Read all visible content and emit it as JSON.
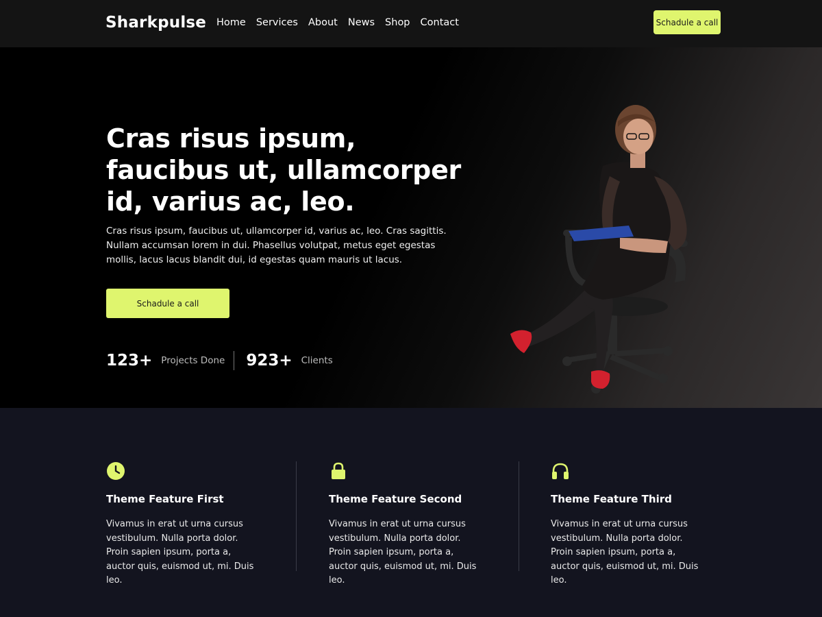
{
  "header": {
    "logo": "Sharkpulse",
    "nav": [
      "Home",
      "Services",
      "About",
      "News",
      "Shop",
      "Contact"
    ],
    "cta": "Schadule a call"
  },
  "hero": {
    "title": "Cras risus ipsum, faucibus ut, ullamcorper id, varius ac, leo.",
    "text": "Cras risus ipsum, faucibus ut, ullamcorper id, varius ac, leo. Cras sagittis. Nullam accumsan lorem in dui. Phasellus volutpat, metus eget egestas mollis, lacus lacus blandit dui, id egestas quam mauris ut lacus.",
    "cta": "Schadule a call",
    "stats": [
      {
        "number": "123+",
        "label": "Projects Done"
      },
      {
        "number": "923+",
        "label": "Clients"
      }
    ]
  },
  "features": [
    {
      "icon": "clock-icon",
      "title": "Theme Feature First",
      "text": "Vivamus in erat ut urna cursus vestibulum. Nulla porta dolor. Proin sapien ipsum, porta a, auctor quis, euismod ut, mi. Duis leo."
    },
    {
      "icon": "lock-icon",
      "title": "Theme Feature Second",
      "text": "Vivamus in erat ut urna cursus vestibulum. Nulla porta dolor. Proin sapien ipsum, porta a, auctor quis, euismod ut, mi. Duis leo."
    },
    {
      "icon": "headphones-icon",
      "title": "Theme Feature Third",
      "text": "Vivamus in erat ut urna cursus vestibulum. Nulla porta dolor. Proin sapien ipsum, porta a, auctor quis, euismod ut, mi. Duis leo."
    }
  ],
  "colors": {
    "accent": "#dff56e",
    "header_bg": "#141414",
    "features_bg": "#13141f"
  }
}
